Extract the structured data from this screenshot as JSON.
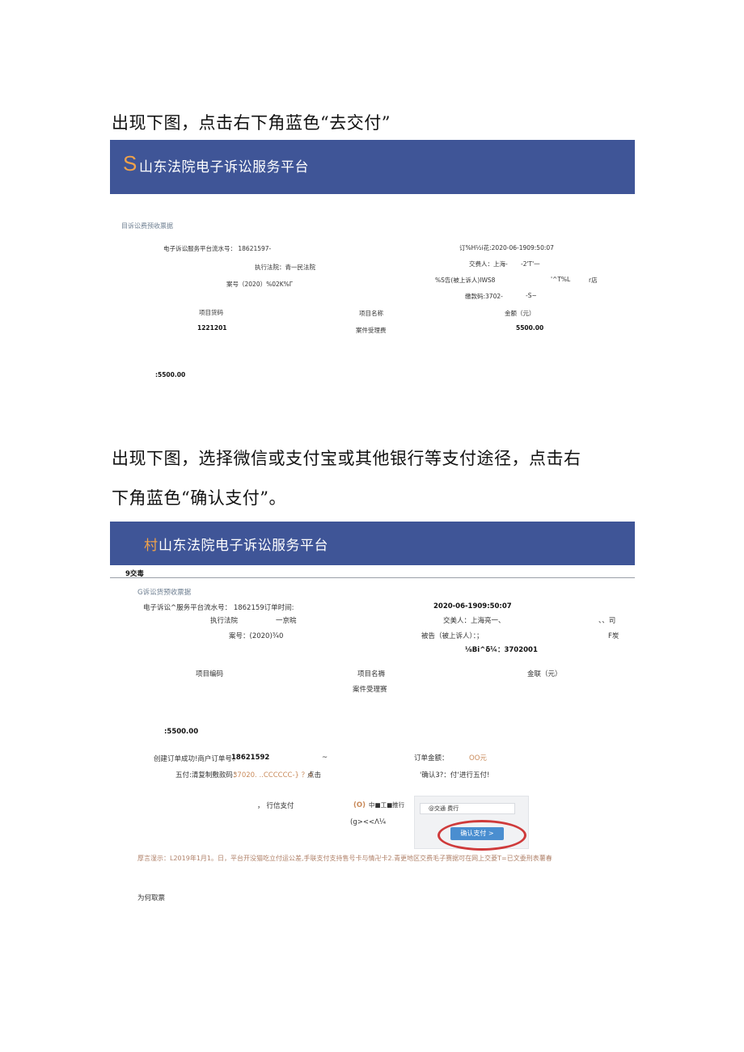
{
  "section1": {
    "instruction": "出现下图，点击右下角蓝色“去交付”",
    "banner": {
      "logo": "S",
      "title": "山东法院电子诉讼服务平台"
    },
    "receipt": {
      "heading": "目诉讼费预收票据",
      "serial": "电子诉讼服务平台流水号： 18621597-",
      "order_time": "订%H½i花:2020-06-1909:50:07",
      "court": "执行法院：青一民法院",
      "payer": "交费人：上海-",
      "payer_tail": "-2'T'一",
      "case_no": "案号（2020）%02K%Γ",
      "defendant": "%S告(被上诉人)IWS8",
      "defendant_tail": "'^T%L",
      "defendant_tail2": "r店",
      "pay_code": "缴款码:3702-",
      "pay_code_tail": "-S~",
      "col_code": "项目货码",
      "col_name": "项目名称",
      "col_amount": "金额（元）",
      "item_code": "1221201",
      "item_name": "案件受理费",
      "item_amount": "5500.00",
      "total": ":5500.00"
    }
  },
  "section2": {
    "instruction_line1": "出现下图，选择微信或支付宝或其他银行等支付途径，点击右",
    "instruction_line2": "下角蓝色“确认支付”。",
    "banner": {
      "logo": "村",
      "title": "山东法院电子诉讼服务平台"
    },
    "nav_label": "9交毒",
    "receipt": {
      "heading": "G诉讼货预收票据",
      "serial": "电子诉讼^服务平台流水号： 1862159订单时间:",
      "order_time": "2020-06-1909:50:07",
      "court_label": "执行法院",
      "court_value": "一京晥",
      "payer": "交美人：上海亮一、",
      "payer_tail": "、、司",
      "case_no": "案号：(2020)¾0",
      "defendant": "被告（被上诉人）：；",
      "defendant_tail": "F炭",
      "pay_code": "⅛Bi^δ¼：3702001",
      "col_code": "项目编码",
      "col_name": "项目名褥",
      "col_amount": "金联（元）",
      "item_name": "案件受理赛",
      "total": ":5500.00"
    },
    "order": {
      "created": "创建订单成功!商户订单号：",
      "order_no": "18621592",
      "tilde": "~",
      "amount_label": "订单金额：",
      "amount_value": "OO元",
      "pay_code_label": "五付:清复制敷款码：",
      "pay_code_value": "37020. ..CCCCCC-} ？4",
      "click": "点击",
      "confirm_hint": "'确认3?：付‘进行五付!"
    },
    "pay_methods": {
      "wechat_prefix": "，",
      "wechat": "行信支付",
      "bank_prefix": "(O)",
      "bank": "中■工■推行",
      "misc": "(g><<Λ¼"
    },
    "thumbnail": {
      "label": "@交通 费行",
      "confirm_button": "确认支付  >"
    },
    "notice": "厚言湿示：L2019年1月1。日，平台开没猫吃立付运公差,手联支付支持售号卡与情卍卡2.青更地区交费毛子赛据可在网上交菱T=已文委刑表薯春",
    "footer_link": "为何取票"
  },
  "colors": {
    "banner": "#3f5597",
    "logo": "#f0a24a",
    "notice": "#b0826a",
    "confirm_button": "#4a8ed0",
    "highlight_ring": "#cf3a3a"
  }
}
